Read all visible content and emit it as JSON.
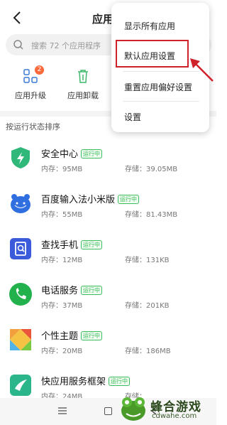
{
  "header": {
    "title": "应用管"
  },
  "search": {
    "placeholder": "搜索 72 个应用程序"
  },
  "tools": [
    {
      "label": "应用升级",
      "badge": "2"
    },
    {
      "label": "应用卸载"
    }
  ],
  "sort_header": "按运行状态排序",
  "apps": [
    {
      "name": "安全中心",
      "status": "运行中",
      "memory": "内存：95MB",
      "storage": "存储：39.05MB"
    },
    {
      "name": "百度输入法小米版",
      "status": "运行中",
      "memory": "内存：55MB",
      "storage": "存储：81.43MB"
    },
    {
      "name": "查找手机",
      "status": "运行中",
      "memory": "内存：12MB",
      "storage": "存储：131KB"
    },
    {
      "name": "电话服务",
      "status": "运行中",
      "memory": "内存：37MB",
      "storage": "存储：201KB"
    },
    {
      "name": "个性主题",
      "status": "运行中",
      "memory": "内存：20MB",
      "storage": "存储：186MB"
    },
    {
      "name": "快应用服务框架",
      "status": "运行中",
      "memory": "内存：24MB",
      "storage": "存储："
    }
  ],
  "menu": {
    "items": [
      "显示所有应用",
      "默认应用设置",
      "重置应用偏好设置",
      "设置"
    ],
    "highlighted_index": 1
  },
  "watermark": {
    "title": "蜂合游戏",
    "url": "cdwahe.com"
  },
  "colors": {
    "accent": "#3dbd5b",
    "highlight": "#d0202a",
    "badge": "#ff6a3d"
  },
  "icons": {
    "back": "back-arrow-icon",
    "search": "search-icon",
    "upgrade": "grid-upgrade-icon",
    "uninstall": "trash-icon"
  }
}
